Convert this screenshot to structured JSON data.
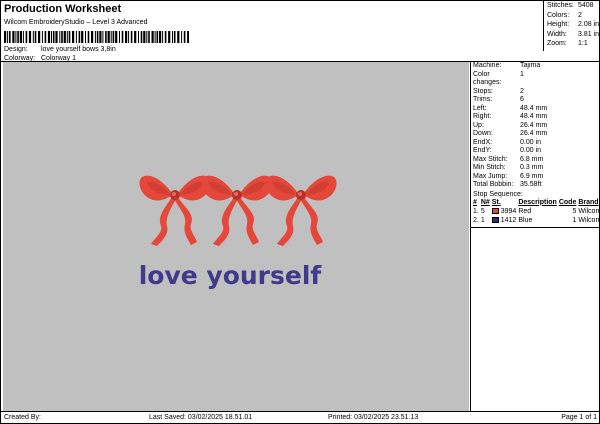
{
  "header": {
    "title": "Production Worksheet",
    "subtitle": "Wilcom EmbroideryStudio – Level 3 Advanced",
    "design_label": "Design:",
    "design_value": "love yourself bows 3,8in",
    "colorway_label": "Colorway:",
    "colorway_value": "Colorway 1"
  },
  "summary": [
    {
      "label": "Stitches:",
      "value": "5408"
    },
    {
      "label": "Colors:",
      "value": "2"
    },
    {
      "label": "Height:",
      "value": "2.08 in"
    },
    {
      "label": "Width:",
      "value": "3.81 in"
    },
    {
      "label": "Zoom:",
      "value": "1:1"
    }
  ],
  "machine": [
    {
      "label": "Machine:",
      "value": "Tajima"
    },
    {
      "label": "Color changes:",
      "value": "1"
    },
    {
      "label": "Stops:",
      "value": "2"
    },
    {
      "label": "Trims:",
      "value": "6"
    },
    {
      "label": "Left:",
      "value": "48.4 mm"
    },
    {
      "label": "Right:",
      "value": "48.4 mm"
    },
    {
      "label": "Up:",
      "value": "26.4 mm"
    },
    {
      "label": "Down:",
      "value": "26.4 mm"
    },
    {
      "label": "EndX:",
      "value": "0.00 in"
    },
    {
      "label": "EndY:",
      "value": "0.00 in"
    },
    {
      "label": "Max Stitch:",
      "value": "6.8 mm"
    },
    {
      "label": "Min Stitch:",
      "value": "0.3 mm"
    },
    {
      "label": "Max Jump:",
      "value": "6.9 mm"
    },
    {
      "label": "Total Bobbin:",
      "value": "35.58ft"
    }
  ],
  "stop_sequence": {
    "title": "Stop Sequence:",
    "headers": [
      "#",
      "N#",
      "St.",
      "Description",
      "Code",
      "Brand"
    ],
    "rows": [
      {
        "num": "1.",
        "n": "5",
        "st": "3994",
        "color": "#e5473a",
        "description": "Red",
        "code": "5",
        "brand": "Wilcom"
      },
      {
        "num": "2.",
        "n": "1",
        "st": "1412",
        "color": "#2e2a7a",
        "description": "Blue",
        "code": "1",
        "brand": "Wilcom"
      }
    ]
  },
  "design": {
    "text": "love yourself",
    "bow_color": "#e5473a",
    "bow_dark": "#b8322a",
    "text_color": "#3f3a8a",
    "background": "#c0c0c0"
  },
  "footer": {
    "created_by": "Created By:",
    "last_saved": "Last Saved: 03/02/2025 18.51.01",
    "printed": "Printed: 03/02/2025 23.51.13",
    "page": "Page 1 of 1"
  }
}
